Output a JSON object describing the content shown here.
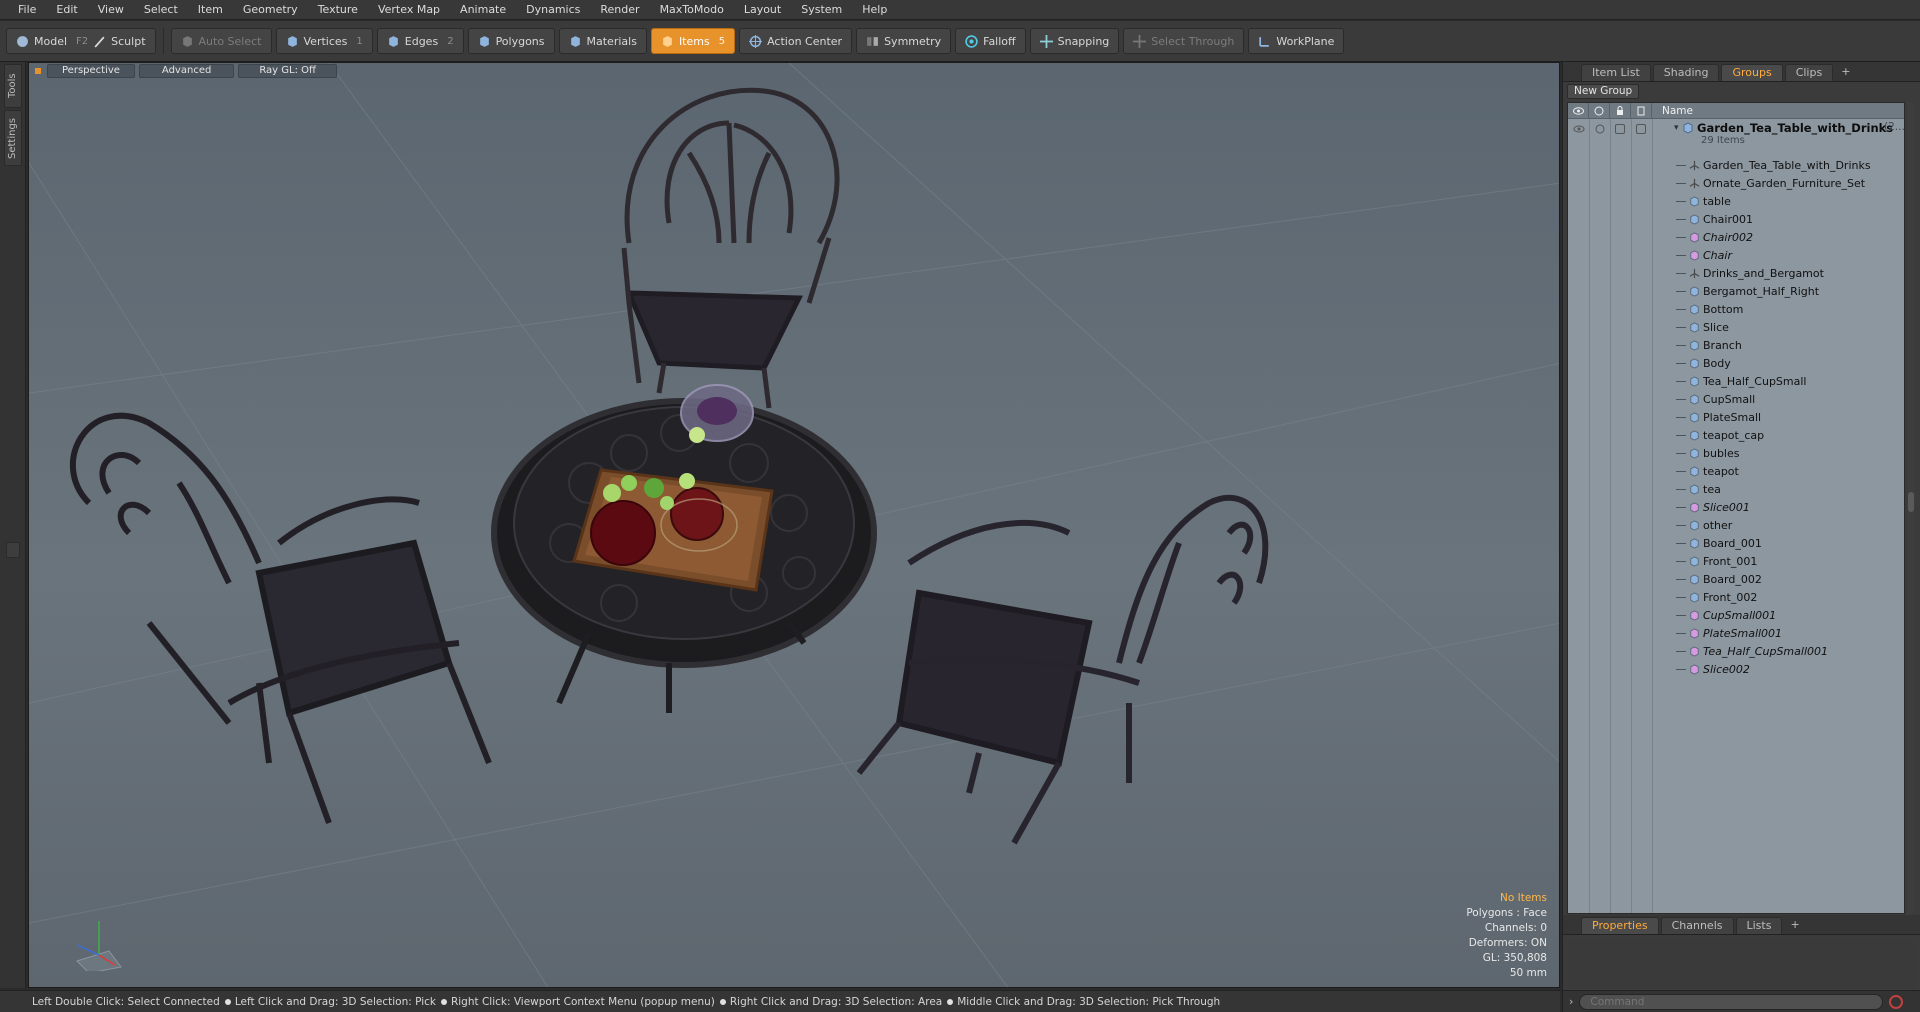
{
  "menu": [
    "File",
    "Edit",
    "View",
    "Select",
    "Item",
    "Geometry",
    "Texture",
    "Vertex Map",
    "Animate",
    "Dynamics",
    "Render",
    "MaxToModo",
    "Layout",
    "System",
    "Help"
  ],
  "toolbar": {
    "model": "Model",
    "model_key": "F2",
    "sculpt": "Sculpt",
    "auto_select": "Auto Select",
    "vertices": "Vertices",
    "vertices_key": "1",
    "edges": "Edges",
    "edges_key": "2",
    "polygons": "Polygons",
    "materials": "Materials",
    "items": "Items",
    "items_key": "5",
    "action_center": "Action Center",
    "symmetry": "Symmetry",
    "falloff": "Falloff",
    "snapping": "Snapping",
    "select_through": "Select Through",
    "workplane": "WorkPlane"
  },
  "side_tabs": [
    "Tools",
    "Settings"
  ],
  "viewport": {
    "view": "Perspective",
    "shading": "Advanced",
    "raygl": "Ray GL: Off",
    "info": {
      "selection": "No Items",
      "polygons": "Polygons : Face",
      "channels": "Channels: 0",
      "deformers": "Deformers: ON",
      "gl": "GL: 350,808",
      "scale": "50 mm"
    }
  },
  "status": [
    "Left Double Click: Select Connected",
    "Left Click and Drag: 3D Selection: Pick",
    "Right Click: Viewport Context Menu (popup menu)",
    "Right Click and Drag: 3D Selection: Area",
    "Middle Click and Drag: 3D Selection: Pick Through"
  ],
  "right_panel": {
    "tabs": [
      "Item List",
      "Shading",
      "Groups",
      "Clips"
    ],
    "active_tab": "Groups",
    "new_group": "New Group",
    "column_name": "Name",
    "root": {
      "label": "Garden_Tea_Table_with_Drinks",
      "suffix": "(2...",
      "count": "29 Items"
    },
    "items": [
      {
        "label": "Garden_Tea_Table_with_Drinks",
        "type": "locator",
        "italic": false
      },
      {
        "label": "Ornate_Garden_Furniture_Set",
        "type": "locator",
        "italic": false
      },
      {
        "label": "table",
        "type": "mesh",
        "italic": false
      },
      {
        "label": "Chair001",
        "type": "mesh",
        "italic": false
      },
      {
        "label": "Chair002",
        "type": "instance",
        "italic": true
      },
      {
        "label": "Chair",
        "type": "instance",
        "italic": true
      },
      {
        "label": "Drinks_and_Bergamot",
        "type": "locator",
        "italic": false
      },
      {
        "label": "Bergamot_Half_Right",
        "type": "mesh",
        "italic": false
      },
      {
        "label": "Bottom",
        "type": "mesh",
        "italic": false
      },
      {
        "label": "Slice",
        "type": "mesh",
        "italic": false
      },
      {
        "label": "Branch",
        "type": "mesh",
        "italic": false
      },
      {
        "label": "Body",
        "type": "mesh",
        "italic": false
      },
      {
        "label": "Tea_Half_CupSmall",
        "type": "mesh",
        "italic": false
      },
      {
        "label": "CupSmall",
        "type": "mesh",
        "italic": false
      },
      {
        "label": "PlateSmall",
        "type": "mesh",
        "italic": false
      },
      {
        "label": "teapot_cap",
        "type": "mesh",
        "italic": false
      },
      {
        "label": "bubles",
        "type": "mesh",
        "italic": false
      },
      {
        "label": "teapot",
        "type": "mesh",
        "italic": false
      },
      {
        "label": "tea",
        "type": "mesh",
        "italic": false
      },
      {
        "label": "Slice001",
        "type": "instance",
        "italic": true
      },
      {
        "label": "other",
        "type": "mesh",
        "italic": false
      },
      {
        "label": "Board_001",
        "type": "mesh",
        "italic": false
      },
      {
        "label": "Front_001",
        "type": "mesh",
        "italic": false
      },
      {
        "label": "Board_002",
        "type": "mesh",
        "italic": false
      },
      {
        "label": "Front_002",
        "type": "mesh",
        "italic": false
      },
      {
        "label": "CupSmall001",
        "type": "instance",
        "italic": true
      },
      {
        "label": "PlateSmall001",
        "type": "instance",
        "italic": true
      },
      {
        "label": "Tea_Half_CupSmall001",
        "type": "instance",
        "italic": true
      },
      {
        "label": "Slice002",
        "type": "instance",
        "italic": true
      }
    ],
    "bottom_tabs": [
      "Properties",
      "Channels",
      "Lists"
    ],
    "bottom_active": "Properties",
    "command_placeholder": "Command"
  },
  "colors": {
    "accent": "#e7922a",
    "tab_active_text": "#ffab3d",
    "mesh_icon": "#8fb4de",
    "instance_icon": "#d59ae0",
    "locator_icon": "#4a4a4a",
    "info_highlight": "#ffb64a"
  }
}
